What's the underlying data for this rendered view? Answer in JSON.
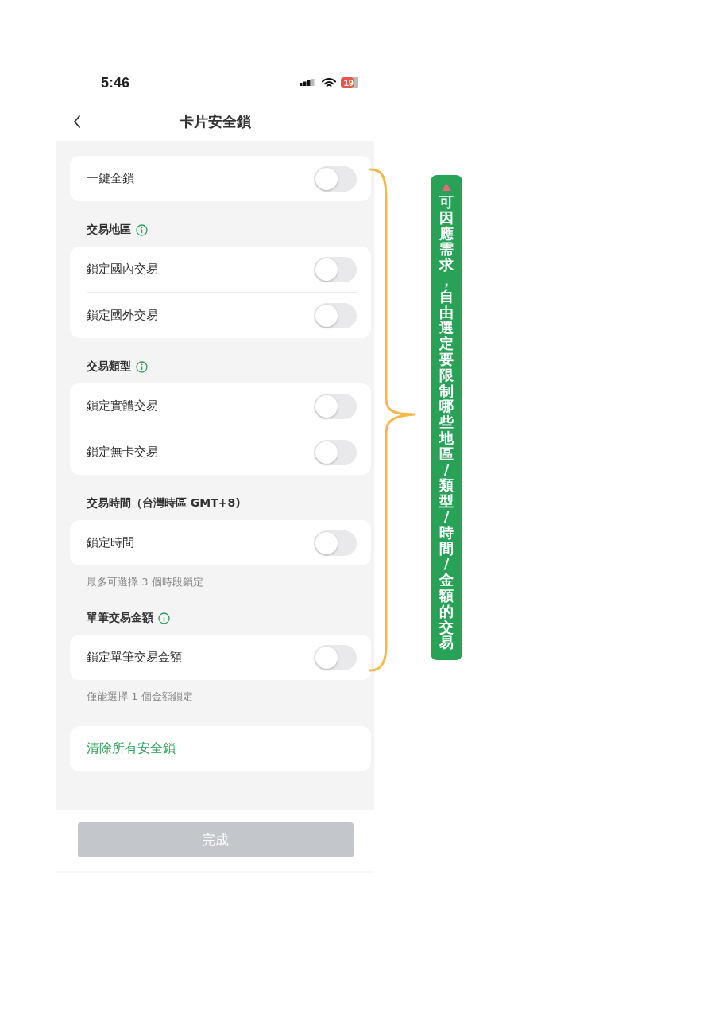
{
  "status_bar": {
    "time": "5:46",
    "battery": "19"
  },
  "nav": {
    "title": "卡片安全鎖"
  },
  "sections": [
    {
      "kind": "card",
      "rows": [
        {
          "label": "一鍵全鎖",
          "on": false
        }
      ]
    },
    {
      "kind": "header",
      "label": "交易地區",
      "info": true
    },
    {
      "kind": "card",
      "rows": [
        {
          "label": "鎖定國內交易",
          "on": false
        },
        {
          "label": "鎖定國外交易",
          "on": false
        }
      ]
    },
    {
      "kind": "header",
      "label": "交易類型",
      "info": true
    },
    {
      "kind": "card",
      "rows": [
        {
          "label": "鎖定實體交易",
          "on": false
        },
        {
          "label": "鎖定無卡交易",
          "on": false
        }
      ]
    },
    {
      "kind": "header",
      "label": "交易時間（台灣時區 GMT+8)",
      "info": false
    },
    {
      "kind": "card",
      "rows": [
        {
          "label": "鎖定時間",
          "on": false
        }
      ]
    },
    {
      "kind": "note",
      "label": "最多可選擇 3 個時段鎖定"
    },
    {
      "kind": "header",
      "label": "單筆交易金額",
      "info": true
    },
    {
      "kind": "card",
      "rows": [
        {
          "label": "鎖定單筆交易金額",
          "on": false
        }
      ]
    },
    {
      "kind": "note",
      "label": "僅能選擇 1 個金額鎖定"
    },
    {
      "kind": "link",
      "label": "清除所有安全鎖"
    }
  ],
  "done_button": {
    "label": "完成",
    "disabled": true
  },
  "annotation": {
    "text": "可因應需求，自由選定要限制哪些地區/類型/時間/金額的交易"
  }
}
